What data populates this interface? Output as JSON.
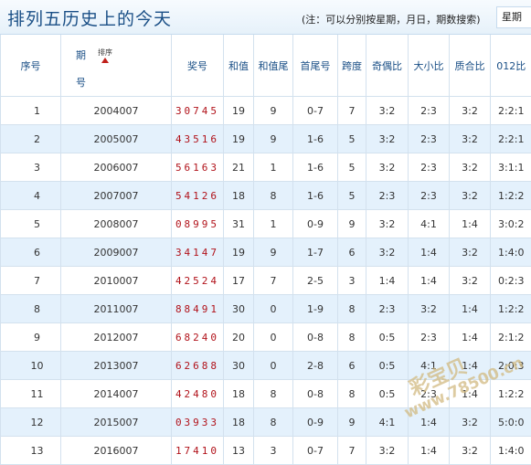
{
  "header": {
    "title": "排列五历史上的今天",
    "note": "(注：可以分别按星期，月日，期数搜索)",
    "tab_weekday": "星期"
  },
  "table": {
    "columns": {
      "no": "序号",
      "period_top": "期",
      "period_bottom": "号",
      "sort": "排序",
      "prize": "奖号",
      "sum": "和值",
      "sum_tail": "和值尾",
      "head_tail": "首尾号",
      "span": "跨度",
      "odd_even": "奇偶比",
      "big_small": "大小比",
      "prime_composite": "质合比",
      "mod012": "012比"
    },
    "rows": [
      {
        "no": "1",
        "period": "2004007",
        "prize": "30745",
        "sum": "19",
        "sum_tail": "9",
        "head_tail": "0-7",
        "span": "7",
        "odd_even": "3:2",
        "big_small": "2:3",
        "prime_composite": "3:2",
        "mod012": "2:2:1"
      },
      {
        "no": "2",
        "period": "2005007",
        "prize": "43516",
        "sum": "19",
        "sum_tail": "9",
        "head_tail": "1-6",
        "span": "5",
        "odd_even": "3:2",
        "big_small": "2:3",
        "prime_composite": "3:2",
        "mod012": "2:2:1"
      },
      {
        "no": "3",
        "period": "2006007",
        "prize": "56163",
        "sum": "21",
        "sum_tail": "1",
        "head_tail": "1-6",
        "span": "5",
        "odd_even": "3:2",
        "big_small": "2:3",
        "prime_composite": "3:2",
        "mod012": "3:1:1"
      },
      {
        "no": "4",
        "period": "2007007",
        "prize": "54126",
        "sum": "18",
        "sum_tail": "8",
        "head_tail": "1-6",
        "span": "5",
        "odd_even": "2:3",
        "big_small": "2:3",
        "prime_composite": "3:2",
        "mod012": "1:2:2"
      },
      {
        "no": "5",
        "period": "2008007",
        "prize": "08995",
        "sum": "31",
        "sum_tail": "1",
        "head_tail": "0-9",
        "span": "9",
        "odd_even": "3:2",
        "big_small": "4:1",
        "prime_composite": "1:4",
        "mod012": "3:0:2"
      },
      {
        "no": "6",
        "period": "2009007",
        "prize": "34147",
        "sum": "19",
        "sum_tail": "9",
        "head_tail": "1-7",
        "span": "6",
        "odd_even": "3:2",
        "big_small": "1:4",
        "prime_composite": "3:2",
        "mod012": "1:4:0"
      },
      {
        "no": "7",
        "period": "2010007",
        "prize": "42524",
        "sum": "17",
        "sum_tail": "7",
        "head_tail": "2-5",
        "span": "3",
        "odd_even": "1:4",
        "big_small": "1:4",
        "prime_composite": "3:2",
        "mod012": "0:2:3"
      },
      {
        "no": "8",
        "period": "2011007",
        "prize": "88491",
        "sum": "30",
        "sum_tail": "0",
        "head_tail": "1-9",
        "span": "8",
        "odd_even": "2:3",
        "big_small": "3:2",
        "prime_composite": "1:4",
        "mod012": "1:2:2"
      },
      {
        "no": "9",
        "period": "2012007",
        "prize": "68240",
        "sum": "20",
        "sum_tail": "0",
        "head_tail": "0-8",
        "span": "8",
        "odd_even": "0:5",
        "big_small": "2:3",
        "prime_composite": "1:4",
        "mod012": "2:1:2"
      },
      {
        "no": "10",
        "period": "2013007",
        "prize": "62688",
        "sum": "30",
        "sum_tail": "0",
        "head_tail": "2-8",
        "span": "6",
        "odd_even": "0:5",
        "big_small": "4:1",
        "prime_composite": "1:4",
        "mod012": "2:0:3"
      },
      {
        "no": "11",
        "period": "2014007",
        "prize": "42480",
        "sum": "18",
        "sum_tail": "8",
        "head_tail": "0-8",
        "span": "8",
        "odd_even": "0:5",
        "big_small": "2:3",
        "prime_composite": "1:4",
        "mod012": "1:2:2"
      },
      {
        "no": "12",
        "period": "2015007",
        "prize": "03933",
        "sum": "18",
        "sum_tail": "8",
        "head_tail": "0-9",
        "span": "9",
        "odd_even": "4:1",
        "big_small": "1:4",
        "prime_composite": "3:2",
        "mod012": "5:0:0"
      },
      {
        "no": "13",
        "period": "2016007",
        "prize": "17410",
        "sum": "13",
        "sum_tail": "3",
        "head_tail": "0-7",
        "span": "7",
        "odd_even": "3:2",
        "big_small": "1:4",
        "prime_composite": "3:2",
        "mod012": "1:4:0"
      }
    ]
  },
  "watermark": {
    "brand": "彩宝贝",
    "url": "www.78500.cn"
  }
}
